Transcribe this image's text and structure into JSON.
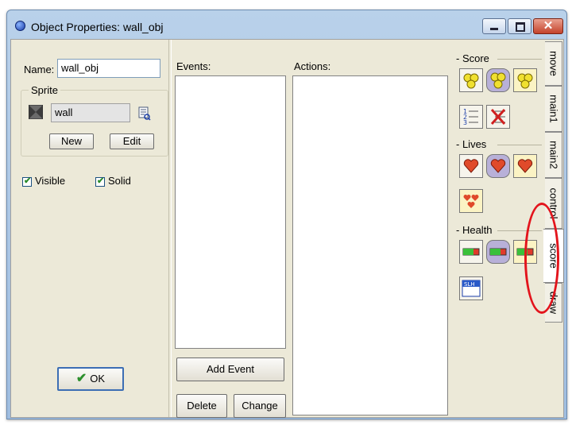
{
  "window": {
    "title": "Object Properties: wall_obj"
  },
  "properties": {
    "name_label": "Name:",
    "name_value": "wall_obj",
    "sprite_legend": "Sprite",
    "sprite_value": "wall",
    "new_label": "New",
    "edit_label": "Edit",
    "visible_label": "Visible",
    "visible_checked": true,
    "solid_label": "Solid",
    "solid_checked": true,
    "ok_label": "OK"
  },
  "events": {
    "label": "Events:",
    "add_label": "Add Event",
    "delete_label": "Delete",
    "change_label": "Change"
  },
  "actions": {
    "label": "Actions:"
  },
  "library": {
    "groups": [
      {
        "label": "Score",
        "actions": [
          "set-score-icon",
          "test-score-icon",
          "draw-score-icon",
          "show-highscore-icon",
          "clear-highscore-icon"
        ]
      },
      {
        "label": "Lives",
        "actions": [
          "set-lives-icon",
          "test-lives-icon",
          "draw-lives-icon",
          "draw-life-images-icon"
        ]
      },
      {
        "label": "Health",
        "actions": [
          "set-health-icon",
          "test-health-icon",
          "draw-health-icon",
          "score-caption-icon"
        ]
      }
    ],
    "caption_glyph": "SLH"
  },
  "tabs": [
    {
      "label": "move",
      "active": false
    },
    {
      "label": "main1",
      "active": false
    },
    {
      "label": "main2",
      "active": false
    },
    {
      "label": "control",
      "active": false
    },
    {
      "label": "score",
      "active": true
    },
    {
      "label": "draw",
      "active": false
    }
  ],
  "colors": {
    "highlight": "#e3141c",
    "accent": "#3c6eb4"
  }
}
